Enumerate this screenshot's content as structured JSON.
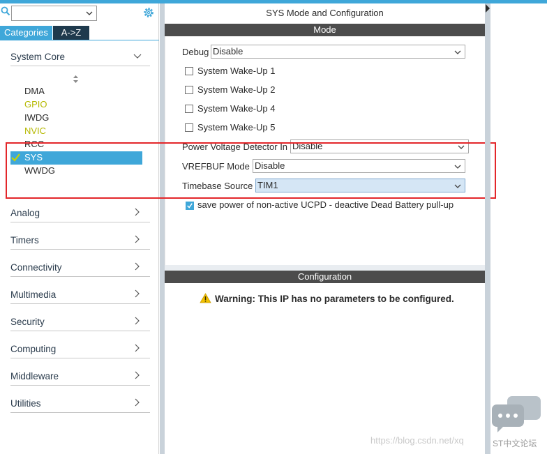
{
  "left": {
    "search_value": "",
    "tabs": [
      "Categories",
      "A->Z"
    ],
    "categories": [
      {
        "label": "System Core",
        "expanded": true
      },
      {
        "label": "Analog"
      },
      {
        "label": "Timers"
      },
      {
        "label": "Connectivity"
      },
      {
        "label": "Multimedia"
      },
      {
        "label": "Security"
      },
      {
        "label": "Computing"
      },
      {
        "label": "Middleware"
      },
      {
        "label": "Utilities"
      }
    ],
    "system_core_items": [
      {
        "label": "DMA",
        "state": "normal"
      },
      {
        "label": "GPIO",
        "state": "warning"
      },
      {
        "label": "IWDG",
        "state": "normal"
      },
      {
        "label": "NVIC",
        "state": "warning"
      },
      {
        "label": "RCC",
        "state": "normal"
      },
      {
        "label": "SYS",
        "state": "selected"
      },
      {
        "label": "WWDG",
        "state": "normal"
      }
    ]
  },
  "main": {
    "title": "SYS Mode and Configuration",
    "mode_header": "Mode",
    "debug": {
      "label": "Debug",
      "value": "Disable"
    },
    "wakeups": [
      {
        "label": "System Wake-Up 1",
        "checked": false
      },
      {
        "label": "System Wake-Up 2",
        "checked": false
      },
      {
        "label": "System Wake-Up 4",
        "checked": false
      },
      {
        "label": "System Wake-Up 5",
        "checked": false
      }
    ],
    "pvd": {
      "label": "Power Voltage Detector In",
      "value": "Disable"
    },
    "vrefbuf": {
      "label": "VREFBUF Mode",
      "value": "Disable"
    },
    "timebase": {
      "label": "Timebase Source",
      "value": "TIM1"
    },
    "ucpd": {
      "label": "save power of non-active UCPD - deactive Dead Battery pull-up",
      "checked": true
    },
    "config_header": "Configuration",
    "warning": "Warning: This IP has no parameters to be configured."
  },
  "watermark": {
    "url": "https://blog.csdn.net/xq",
    "brand": "ST中文论坛"
  },
  "colors": {
    "accent": "#3fa7d9",
    "dark_tab": "#1f3a4d",
    "header_bar": "#4c4c4c",
    "warning_item": "#b5b800",
    "highlight_box": "#e3262a"
  }
}
